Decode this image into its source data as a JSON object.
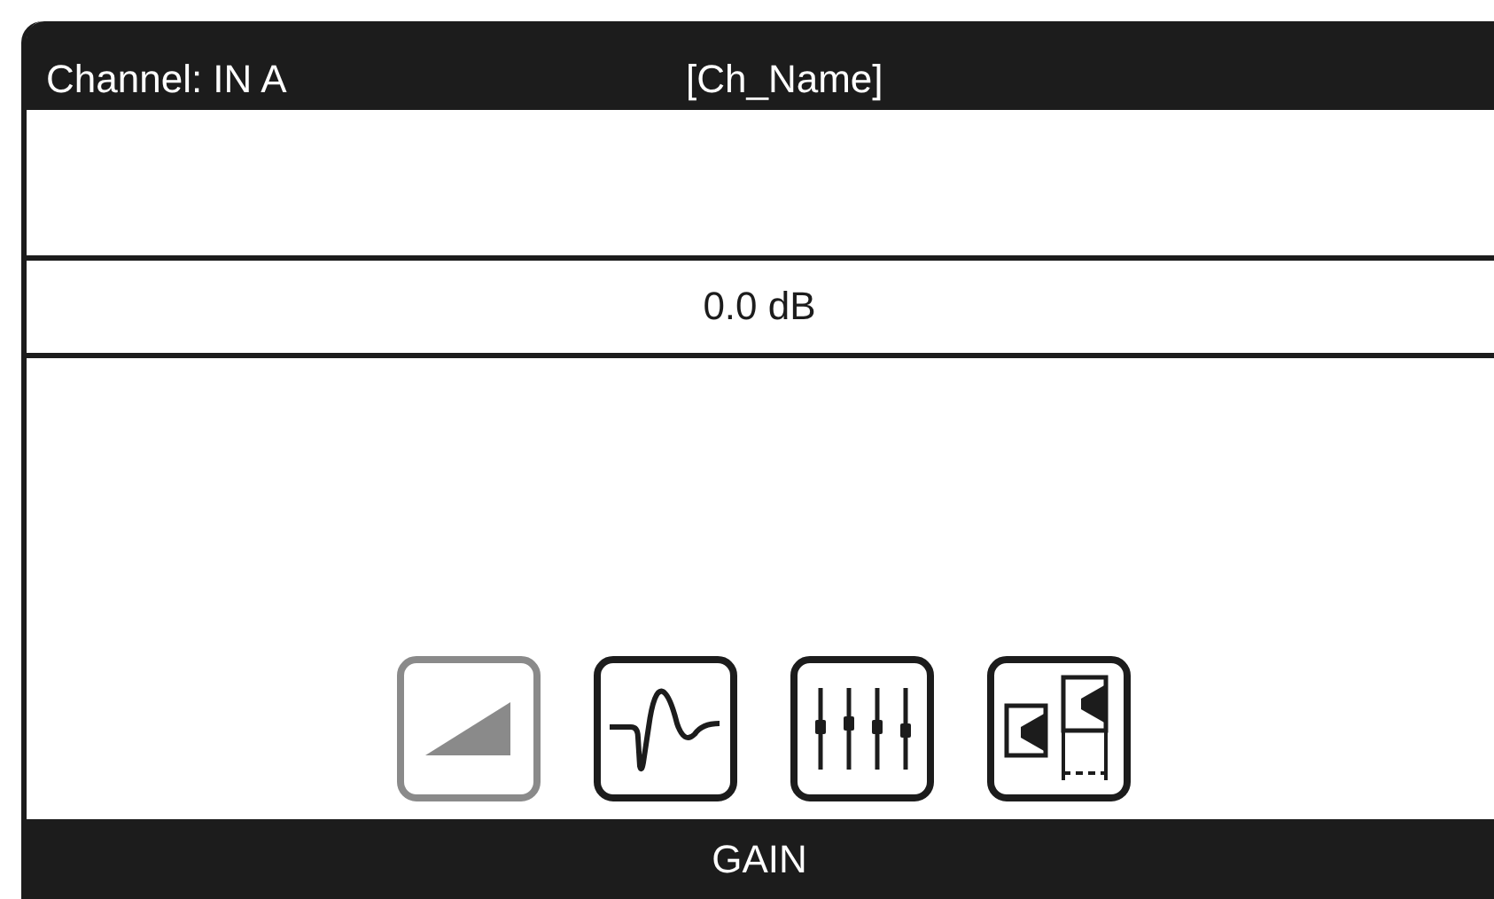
{
  "header": {
    "channel": "Channel: IN A",
    "name": "[Ch_Name]"
  },
  "gain_value": "0.0 dB",
  "modules": [
    {
      "kind": "gain",
      "selected": true
    },
    {
      "kind": "eq",
      "selected": false
    },
    {
      "kind": "faders",
      "selected": false
    },
    {
      "kind": "routing",
      "selected": false
    }
  ],
  "footer": {
    "title": "GAIN"
  }
}
